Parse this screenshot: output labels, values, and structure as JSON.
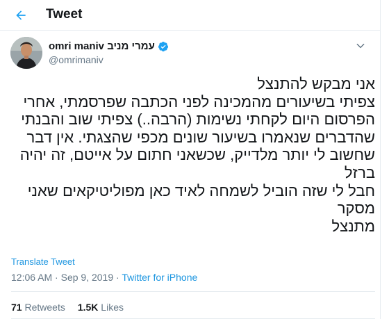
{
  "header": {
    "back_icon": "arrow-left-icon",
    "title": "Tweet"
  },
  "author": {
    "display_name": "omri maniv עמרי מניב",
    "handle": "@omrimaniv",
    "verified_icon": "verified-badge-icon",
    "menu_icon": "chevron-down-icon"
  },
  "tweet": {
    "text": "אני מבקש להתנצל\nצפיתי בשיעורים מהמכינה לפני הכתבה שפרסמתי, אחרי הפרסום היום לקחתי נשימות (הרבה..) צפיתי שוב והבנתי שהדברים שנאמרו בשיעור שונים מכפי שהצגתי. אין דבר שחשוב לי יותר מלדייק, שכשאני חתום על אייטם, זה יהיה ברזל\nחבל לי שזה הוביל לשמחה לאיד כאן מפוליטיקאים שאני מסקר\nמתנצל",
    "translate_label": "Translate Tweet",
    "time": "12:06 AM",
    "date": "Sep 9, 2019",
    "separator": "·",
    "source": "Twitter for iPhone"
  },
  "stats": {
    "retweets_count": "71",
    "retweets_label": "Retweets",
    "likes_count": "1.5K",
    "likes_label": "Likes"
  },
  "colors": {
    "accent": "#1b95e0",
    "text_primary": "#14171a",
    "text_secondary": "#657786",
    "divider": "#e6ecf0"
  }
}
